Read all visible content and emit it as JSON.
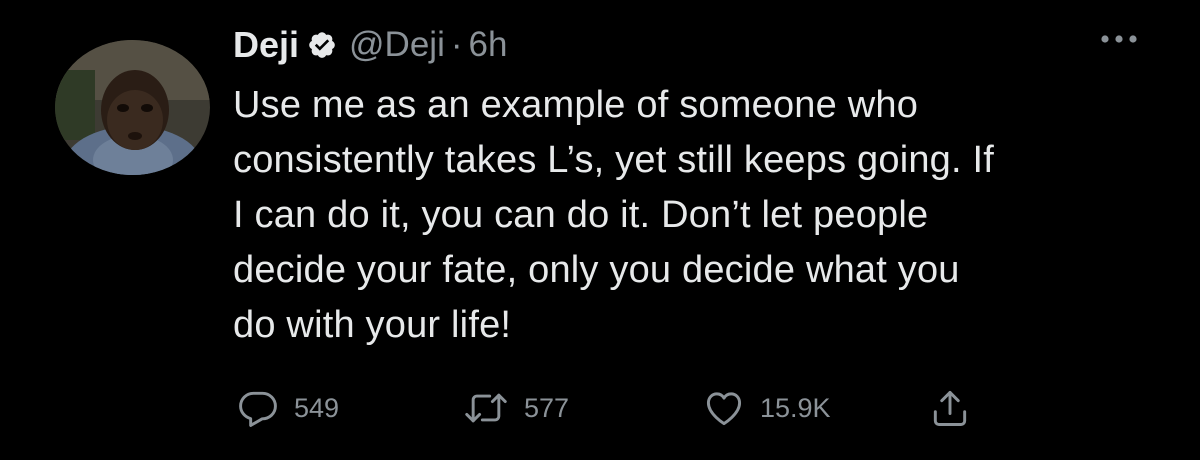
{
  "tweet": {
    "display_name": "Deji",
    "handle": "@Deji",
    "separator": "·",
    "time": "6h",
    "text_lines": [
      "Use me as an example of someone who",
      "consistently takes L’s, yet still keeps going. If",
      "I can do it, you can do it. Don’t let people",
      "decide your fate, only you decide what you",
      "do with your life!"
    ],
    "actions": {
      "reply_count": "549",
      "retweet_count": "577",
      "like_count": "15.9K"
    }
  },
  "icons": {
    "verified": "verified-badge-icon",
    "more": "more-options-icon",
    "reply": "reply-icon",
    "retweet": "retweet-icon",
    "like": "like-icon",
    "share": "share-icon"
  },
  "colors": {
    "background": "#000000",
    "primary_text": "#e7e9ea",
    "secondary_text": "#8b9298"
  }
}
